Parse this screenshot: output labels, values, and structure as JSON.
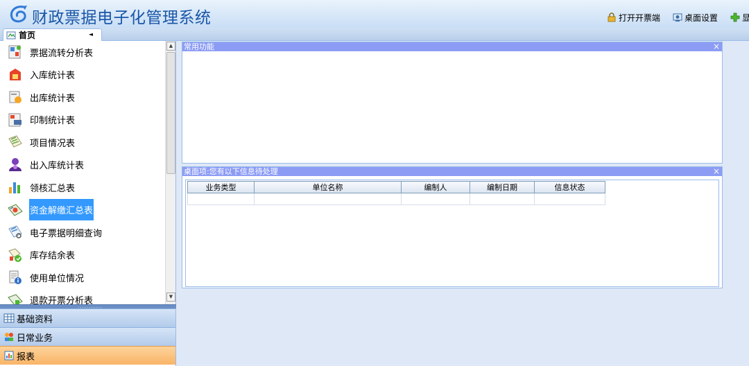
{
  "app": {
    "title": "财政票据电子化管理系统",
    "links": [
      {
        "icon": "lock-icon",
        "label": "打开开票端"
      },
      {
        "icon": "desktop-settings-icon",
        "label": "桌面设置"
      },
      {
        "icon": "plus-icon",
        "label": "显示"
      }
    ]
  },
  "tabs": [
    {
      "label": "首页",
      "icon": "home-page-icon",
      "arrow": "◄"
    }
  ],
  "sidebar": {
    "items": [
      {
        "label": "票据流转分析表",
        "icon": "flow-analysis-icon"
      },
      {
        "label": "入库统计表",
        "icon": "inbound-stats-icon"
      },
      {
        "label": "出库统计表",
        "icon": "outbound-stats-icon"
      },
      {
        "label": "印制统计表",
        "icon": "print-stats-icon"
      },
      {
        "label": "项目情况表",
        "icon": "project-icon"
      },
      {
        "label": "出入库统计表",
        "icon": "inout-stats-icon"
      },
      {
        "label": "领核汇总表",
        "icon": "bar-chart-icon"
      },
      {
        "label": "资金解缴汇总表",
        "icon": "fund-remit-icon",
        "selected": true
      },
      {
        "label": "电子票据明细查询",
        "icon": "detail-query-icon"
      },
      {
        "label": "库存结余表",
        "icon": "inventory-icon"
      },
      {
        "label": "使用单位情况",
        "icon": "unit-info-icon"
      },
      {
        "label": "退款开票分析表",
        "icon": "refund-analysis-icon"
      }
    ],
    "scroll_up": "▲",
    "scroll_down": "▼",
    "splitter_dots": "...........",
    "sections": [
      {
        "label": "基础资料",
        "icon": "table-icon"
      },
      {
        "label": "日常业务",
        "icon": "people-icon"
      },
      {
        "label": "报表",
        "icon": "report-icon"
      }
    ]
  },
  "panels": {
    "common": {
      "title": "常用功能",
      "close": "×"
    },
    "todo": {
      "title": "桌面项:您有以下信息待处理",
      "close": "×",
      "columns": [
        "业务类型",
        "单位名称",
        "编制人",
        "编制日期",
        "信息状态"
      ]
    }
  }
}
